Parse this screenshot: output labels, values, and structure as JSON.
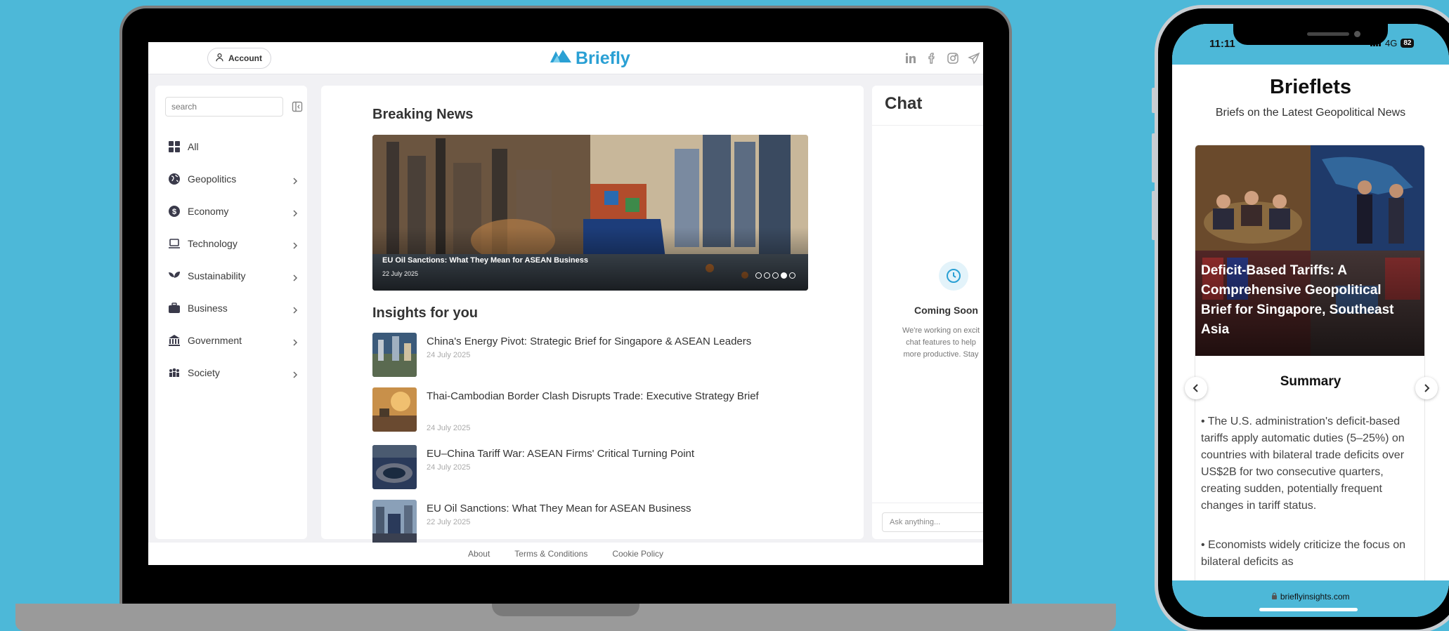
{
  "header": {
    "account_label": "Account",
    "brand": "Briefly",
    "social_icons": [
      "linkedin-icon",
      "facebook-icon",
      "instagram-icon",
      "telegram-icon"
    ]
  },
  "sidebar": {
    "search_placeholder": "search",
    "items": [
      {
        "label": "All",
        "icon": "grid-icon"
      },
      {
        "label": "Geopolitics",
        "icon": "globe-icon"
      },
      {
        "label": "Economy",
        "icon": "dollar-icon"
      },
      {
        "label": "Technology",
        "icon": "laptop-icon"
      },
      {
        "label": "Sustainability",
        "icon": "leaf-icon"
      },
      {
        "label": "Business",
        "icon": "briefcase-icon"
      },
      {
        "label": "Government",
        "icon": "building-icon"
      },
      {
        "label": "Society",
        "icon": "people-icon"
      }
    ]
  },
  "main": {
    "breaking_title": "Breaking News",
    "hero": {
      "title": "EU Oil Sanctions: What They Mean for ASEAN Business",
      "date": "22 July 2025",
      "slide_count": 5,
      "active_slide": 4
    },
    "insights_title": "Insights for you",
    "insights": [
      {
        "title": "China's Energy Pivot: Strategic Brief for Singapore & ASEAN Leaders",
        "date": "24 July 2025"
      },
      {
        "title": "Thai-Cambodian Border Clash Disrupts Trade: Executive Strategy Brief",
        "date": "24 July 2025"
      },
      {
        "title": "EU–China Tariff War: ASEAN Firms' Critical Turning Point",
        "date": "24 July 2025"
      },
      {
        "title": "EU Oil Sanctions: What They Mean for ASEAN Business",
        "date": "22 July 2025"
      }
    ]
  },
  "chat": {
    "title": "Chat",
    "coming_soon": "Coming Soon",
    "description_lines": [
      "We're working on excit",
      "chat features to help",
      "more productive. Stay"
    ],
    "input_placeholder": "Ask anything..."
  },
  "footer": {
    "links": [
      "About",
      "Terms & Conditions",
      "Cookie Policy"
    ]
  },
  "phone": {
    "time": "11:11",
    "network": "4G",
    "battery": "82",
    "title": "Brieflets",
    "subtitle": "Briefs on the Latest Geopolitical News",
    "card_headline": "Deficit-Based Tariffs: A Comprehensive Geopolitical Brief for Singapore, Southeast Asia",
    "summary_title": "Summary",
    "summary_paragraphs": [
      "• The U.S. administration's deficit-based tariffs apply automatic duties (5–25%) on countries with bilateral trade deficits over US$2B for two consecutive quarters, creating sudden, potentially frequent changes in tariff status.",
      "• Economists widely criticize the focus on bilateral deficits as"
    ],
    "url": "brieflyinsights.com"
  }
}
